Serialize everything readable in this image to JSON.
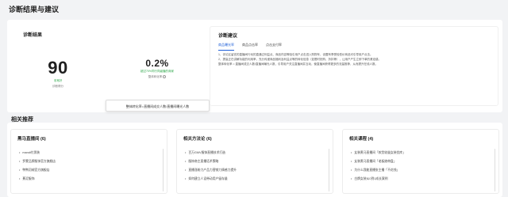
{
  "page": {
    "title": "诊断结果与建议"
  },
  "result": {
    "title": "诊断结果",
    "score": {
      "value": "90",
      "status": "非常好",
      "label": "诊断得分"
    },
    "conversion": {
      "value": "0.2%",
      "status": "超过70%同行同级播的商家",
      "label": "整体转化率"
    },
    "tooltip": "整体转化率=直播间成交人数/直播间曝光人数"
  },
  "suggestion": {
    "title": "诊断建议",
    "tabs": [
      "商品曝光率",
      "商品点击率",
      "点击支付率"
    ],
    "lines": [
      "1、评论区留言的直播间行动的直通过利益点、商品内容等吸引用户点击进入购物车，设置有享受较低价商品可引导用户点击。",
      "2、提高正在讲解功能的利用率，充分传递商品福利及利益点等的转化信息（如限时抢购、折扣等），让用户产生立即下单的紧迫感。",
      "整体转化率 = 直播间成交人数/直播间曝光人数，引导用户关注直播间并互动，使直播间获得更多的流量推荐，从而提升在线人数。"
    ]
  },
  "recommend": {
    "title": "相关推荐",
    "cards": [
      {
        "title": "黑马直播间 (6)",
        "items": [
          "mandi付男装",
          "罗蒙品牌服饰官方旗舰店",
          "鸭鸭羽绒官方旗舰店",
          "蕉泥服饰"
        ]
      },
      {
        "title": "相关方法论 (6)",
        "items": [
          "百万GMV服饰直播技术打造",
          "服饰商主直播话术策略",
          "直播涨粉力产品力营销力情感力提升",
          "如何建立人设带动用户留存量"
        ]
      },
      {
        "title": "相关课程 (4)",
        "items": [
          "女装黑马直播间「款货较量女装优库」",
          "女装黑马直播间「老板娘带盘」",
          "为什么我能直播张主播「不花钱」",
          "白牌女装从0到1成长案例"
        ]
      }
    ]
  }
}
